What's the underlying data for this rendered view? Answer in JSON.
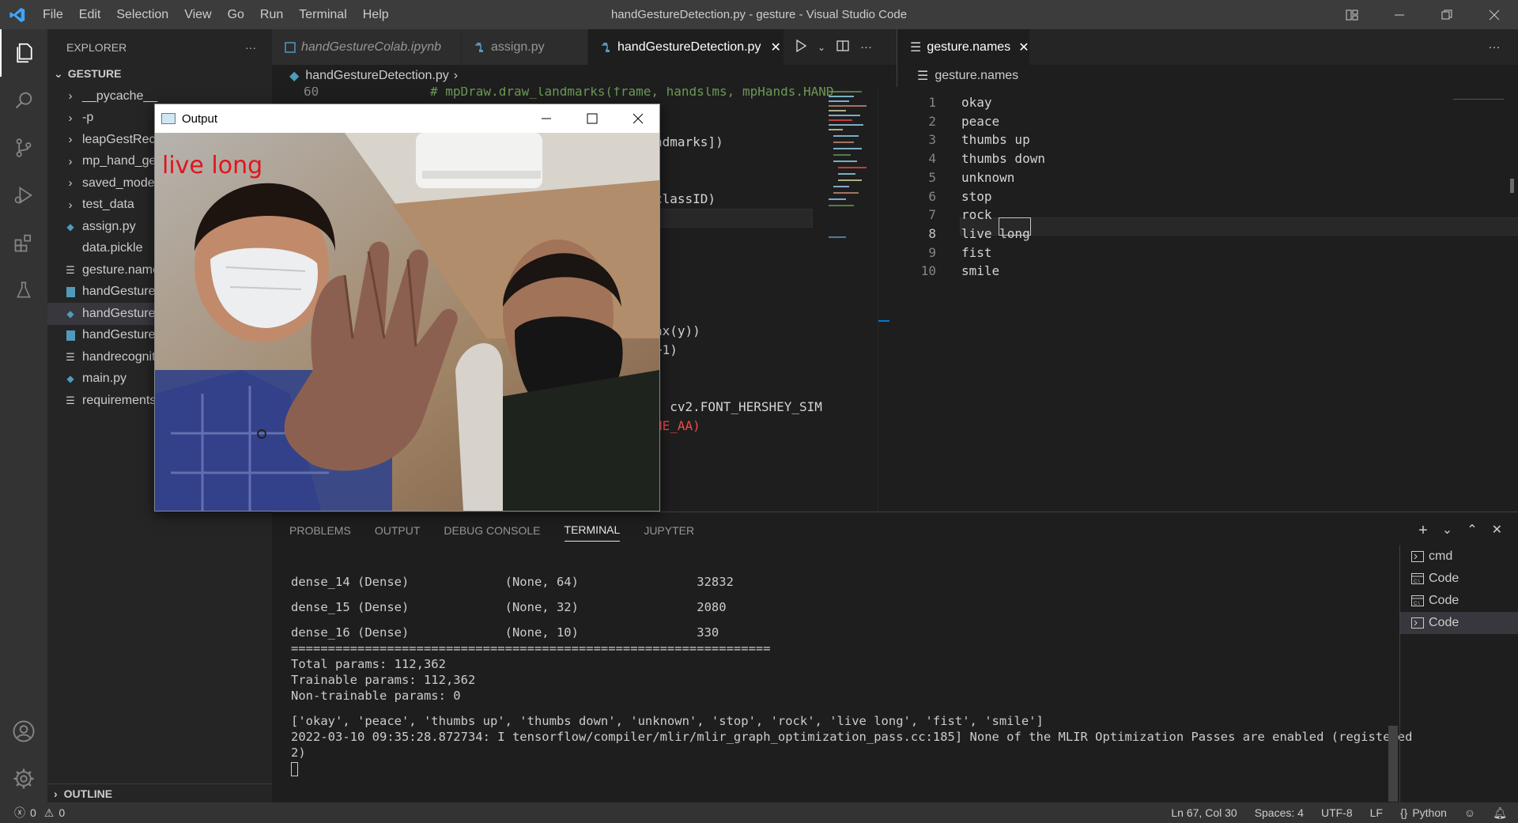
{
  "window": {
    "title": "handGestureDetection.py - gesture - Visual Studio Code"
  },
  "menu": [
    "File",
    "Edit",
    "Selection",
    "View",
    "Go",
    "Run",
    "Terminal",
    "Help"
  ],
  "sidebar": {
    "header": "EXPLORER",
    "folder": "GESTURE",
    "items": [
      {
        "label": "__pycache__",
        "kind": "folder"
      },
      {
        "label": "-p",
        "kind": "folder"
      },
      {
        "label": "leapGestRecog",
        "kind": "folder"
      },
      {
        "label": "mp_hand_gesture",
        "kind": "folder"
      },
      {
        "label": "saved_model",
        "kind": "folder"
      },
      {
        "label": "test_data",
        "kind": "folder"
      },
      {
        "label": "assign.py",
        "kind": "python"
      },
      {
        "label": "data.pickle",
        "kind": "file"
      },
      {
        "label": "gesture.names",
        "kind": "text"
      },
      {
        "label": "handGestureColab.ipynb",
        "kind": "notebook"
      },
      {
        "label": "handGestureDetection.py",
        "kind": "python",
        "selected": true
      },
      {
        "label": "handGestureRecognition.ipynb",
        "kind": "notebook"
      },
      {
        "label": "handrecognition",
        "kind": "text"
      },
      {
        "label": "main.py",
        "kind": "python"
      },
      {
        "label": "requirements.txt",
        "kind": "text"
      }
    ],
    "outline": "OUTLINE"
  },
  "editor_left": {
    "tabs": [
      {
        "label": "handGestureColab.ipynb",
        "italic": true,
        "icon": "notebook"
      },
      {
        "label": "assign.py",
        "italic": false,
        "icon": "python"
      },
      {
        "label": "handGestureDetection.py",
        "italic": false,
        "icon": "python",
        "active": true
      }
    ],
    "breadcrumb": "handGestureDetection.py",
    "line_no_visible": "60",
    "code": [
      {
        "text": "# mpDraw.draw_landmarks(frame, handslms, mpHands.HAND",
        "color": "#6a9955"
      },
      {
        "text": "ndmarks])",
        "color": "#d4d4d4"
      },
      {
        "text": ")",
        "color": "#d4d4d4"
      },
      {
        "text": "]",
        "color": "#d4d4d4"
      },
      {
        "text": "classID)",
        "color": "#d4d4d4"
      },
      {
        "text": "ax(y))",
        "color": "#d4d4d4"
      },
      {
        "text": "+1)",
        "color": "#d4d4d4"
      },
      {
        "text": ", cv2.FONT_HERSHEY_SIM",
        "color": "#d4d4d4"
      },
      {
        "text": "NE_AA)",
        "color": "#f44747"
      }
    ]
  },
  "editor_right": {
    "tab": "gesture.names",
    "breadcrumb": "gesture.names",
    "lines": [
      "okay",
      "peace",
      "thumbs up",
      "thumbs down",
      "unknown",
      "stop",
      "rock",
      "live long",
      "fist",
      "smile"
    ],
    "current_line": 8
  },
  "output_window": {
    "title": "Output",
    "label": "live long"
  },
  "panel": {
    "tabs": [
      "PROBLEMS",
      "OUTPUT",
      "DEBUG CONSOLE",
      "TERMINAL",
      "JUPYTER"
    ],
    "active_tab": "TERMINAL",
    "terminal_lines": [
      "_________________________________________________________________",
      "dense_14 (Dense)             (None, 64)                32832",
      "_________________________________________________________________",
      "dense_15 (Dense)             (None, 32)                2080",
      "_________________________________________________________________",
      "dense_16 (Dense)             (None, 10)                330",
      "=================================================================",
      "Total params: 112,362",
      "Trainable params: 112,362",
      "Non-trainable params: 0",
      "_________________________________________________________________",
      "['okay', 'peace', 'thumbs up', 'thumbs down', 'unknown', 'stop', 'rock', 'live long', 'fist', 'smile']",
      "2022-03-10 09:35:28.872734: I tensorflow/compiler/mlir/mlir_graph_optimization_pass.cc:185] None of the MLIR Optimization Passes are enabled (registered",
      "2)"
    ],
    "terminals": [
      {
        "label": "cmd",
        "icon": "terminal"
      },
      {
        "label": "Code",
        "icon": "cmd-window"
      },
      {
        "label": "Code",
        "icon": "cmd-window"
      },
      {
        "label": "Code",
        "icon": "terminal",
        "selected": true
      }
    ]
  },
  "statusbar": {
    "errors": "0",
    "warnings": "0",
    "position": "Ln 67, Col 30",
    "spaces": "Spaces: 4",
    "encoding": "UTF-8",
    "eol": "LF",
    "language": "Python"
  },
  "colors": {
    "accent": "#007acc",
    "label_red": "#e0141e",
    "keyword_orange": "#f44747",
    "comment_green": "#6a9955"
  }
}
